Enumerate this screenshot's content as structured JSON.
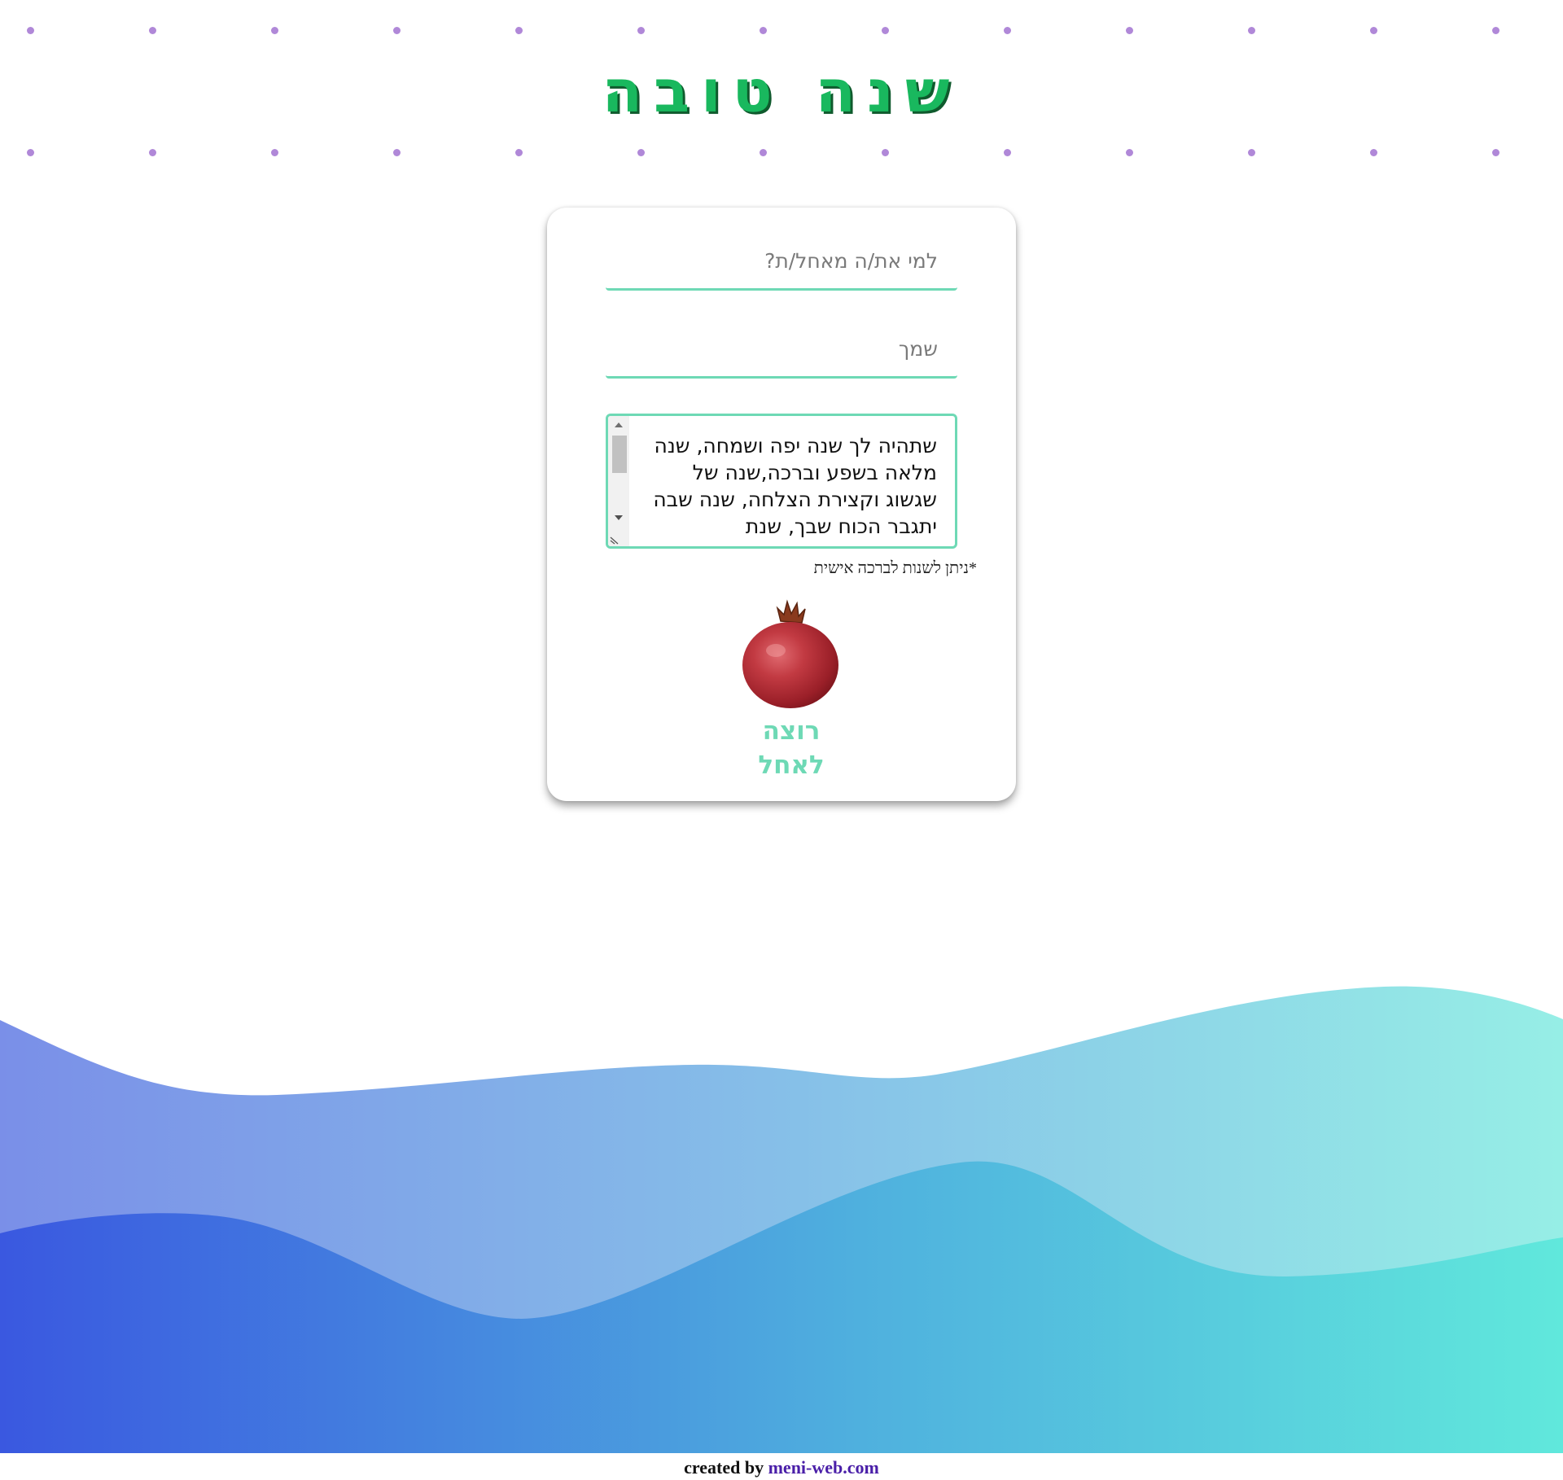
{
  "header": {
    "title": "שנה טובה"
  },
  "form": {
    "to_placeholder": "למי את/ה מאחל/ת?",
    "from_placeholder": "שמך",
    "message_text": "שתהיה לך שנה יפה ושמחה, שנה מלאה בשפע וברכה,שנה של שגשוג וקצירת הצלחה, שנה שבה יתגבר הכוח שבך, שנת",
    "note": "*ניתן לשנות לברכה אישית",
    "submit_label": "רוצה לאחל"
  },
  "footer": {
    "prefix": "created by",
    "link_text": "meni-web.com"
  },
  "colors": {
    "title": "#19b85e",
    "accent": "#6ed9b5",
    "dots": "#b088d8",
    "wave_back_left": "#7a8fe8",
    "wave_back_right": "#96eee6",
    "wave_front_left": "#3a58e0",
    "wave_front_right": "#60e8dc",
    "footer_link": "#4a1fa8"
  },
  "icons": {
    "decoration": "pomegranate-icon"
  }
}
